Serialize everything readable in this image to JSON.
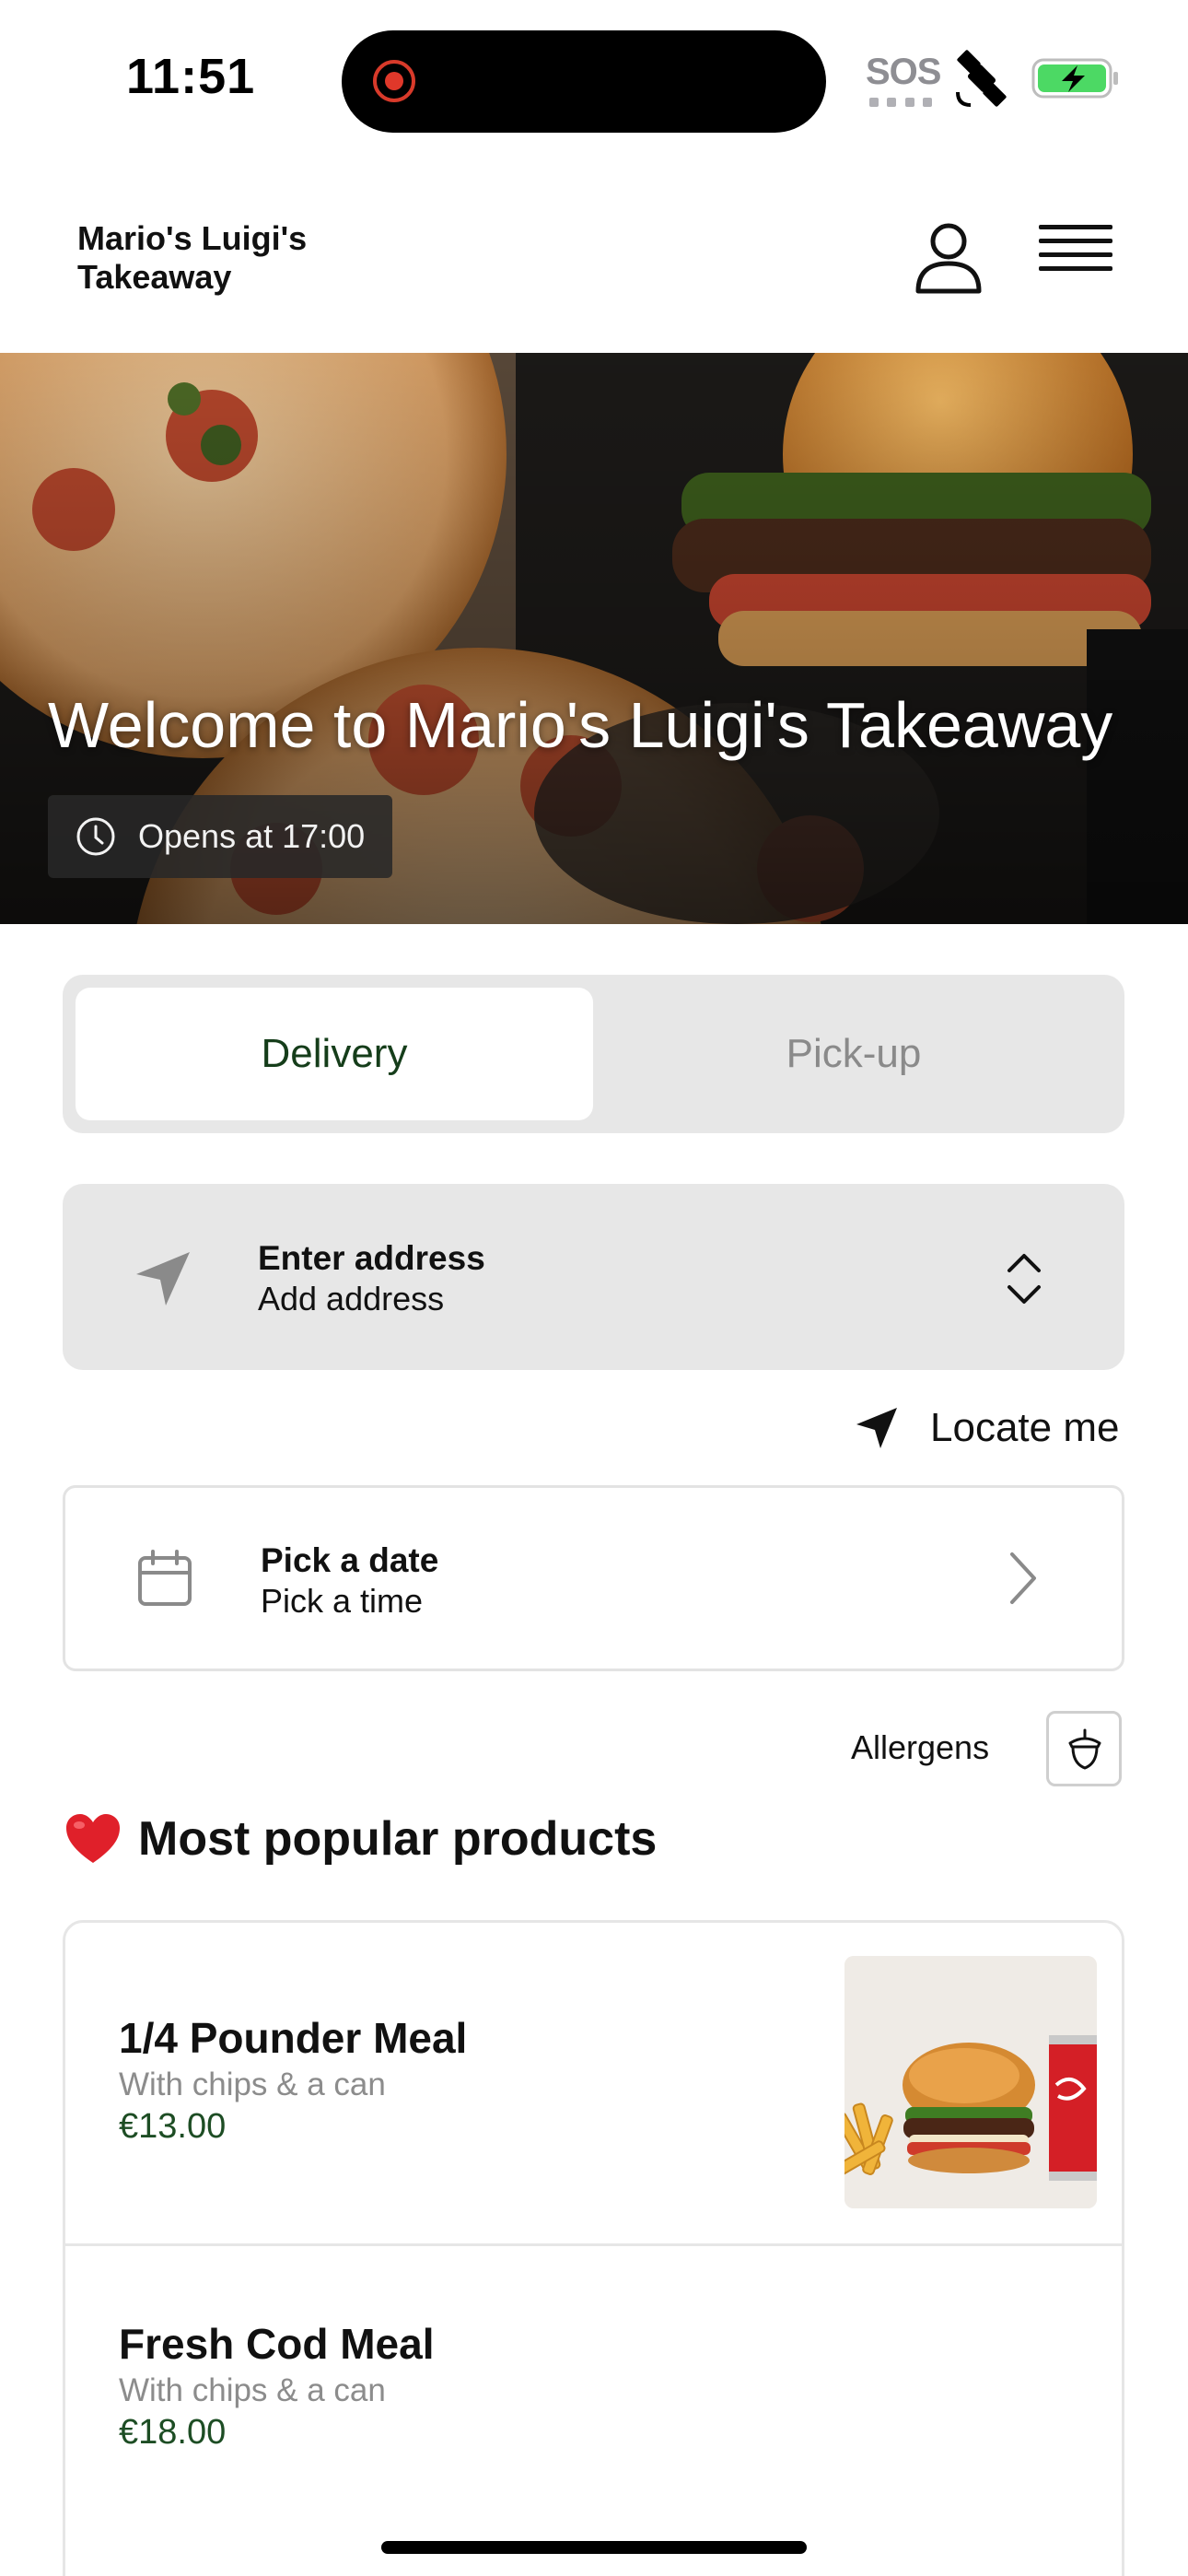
{
  "status_bar": {
    "time": "11:51",
    "sos_label": "SOS",
    "icons": [
      "screen-recording-icon",
      "satellite-icon",
      "battery-charging-icon"
    ],
    "battery_color": "#4cd964"
  },
  "header": {
    "brand": "Mario's Luigi's Takeaway",
    "icons": [
      "user-account-icon",
      "hamburger-menu-icon"
    ]
  },
  "hero": {
    "title": "Welcome to Mario's Luigi's Takeaway",
    "opening_status": "Opens at 17:00"
  },
  "order_mode": {
    "options": [
      "Delivery",
      "Pick-up"
    ],
    "selected": "Delivery",
    "accent_color": "#153d1a"
  },
  "address": {
    "title": "Enter address",
    "subtitle": "Add address"
  },
  "locate": {
    "label": "Locate me"
  },
  "schedule": {
    "title": "Pick a date",
    "subtitle": "Pick a time"
  },
  "allergens": {
    "label": "Allergens"
  },
  "popular": {
    "heading": "Most popular products",
    "products": [
      {
        "name": "1/4 Pounder Meal",
        "description": "With chips & a can",
        "price": "€13.00",
        "has_image": true
      },
      {
        "name": "Fresh Cod Meal",
        "description": "With chips & a can",
        "price": "€18.00",
        "has_image": false
      }
    ]
  }
}
